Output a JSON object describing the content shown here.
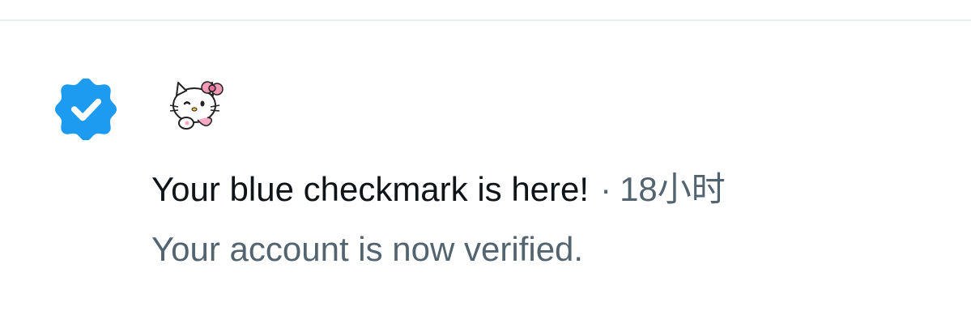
{
  "notification": {
    "icon": "verified-badge-icon",
    "avatar": "hello-kitty-avatar",
    "title": "Your blue checkmark is here!",
    "separator": "·",
    "time": "18小时",
    "subtitle": "Your account is now verified."
  },
  "colors": {
    "badge": "#1d9bf0",
    "text_primary": "#0f1419",
    "text_secondary": "#536471",
    "divider": "#e8edee"
  }
}
